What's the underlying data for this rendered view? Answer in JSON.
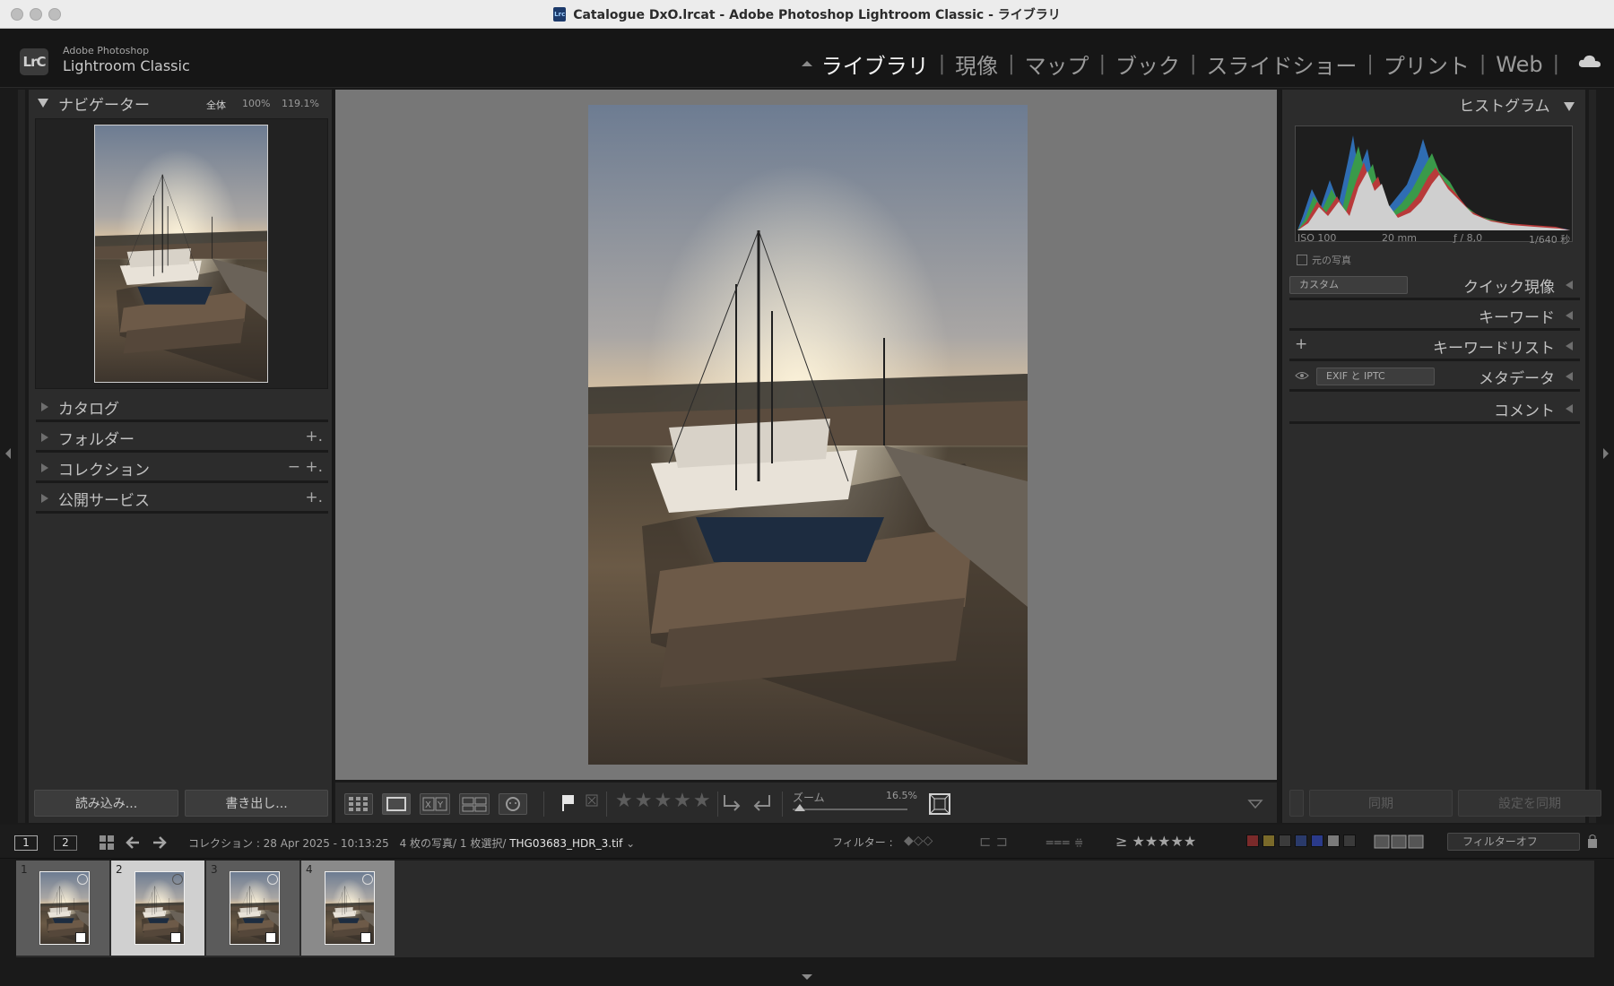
{
  "window": {
    "title": "Catalogue DxO.lrcat - Adobe Photoshop Lightroom Classic - ライブラリ"
  },
  "brand": {
    "line1": "Adobe Photoshop",
    "line2": "Lightroom Classic",
    "logo": "LrC"
  },
  "modules": [
    {
      "label": "ライブラリ",
      "active": true
    },
    {
      "label": "現像"
    },
    {
      "label": "マップ"
    },
    {
      "label": "ブック"
    },
    {
      "label": "スライドショー"
    },
    {
      "label": "プリント"
    },
    {
      "label": "Web"
    }
  ],
  "navigator": {
    "title": "ナビゲーター",
    "fit": "全体",
    "z100": "100%",
    "zcustom": "119.1%"
  },
  "left_sections": [
    {
      "label": "カタログ"
    },
    {
      "label": "フォルダー",
      "action": "+."
    },
    {
      "label": "コレクション",
      "action": "− +."
    },
    {
      "label": "公開サービス",
      "action": "+."
    }
  ],
  "left_buttons": {
    "import": "読み込み...",
    "export": "書き出し..."
  },
  "histogram": {
    "title": "ヒストグラム",
    "iso": "ISO 100",
    "focal": "20 mm",
    "aperture": "ƒ / 8,0",
    "shutter": "1/640 秒",
    "original": "元の写真"
  },
  "right_sections": {
    "quick": {
      "label": "クイック現像",
      "select": "カスタム"
    },
    "keywords": {
      "label": "キーワード"
    },
    "keywordlist": {
      "label": "キーワードリスト",
      "plus": "+"
    },
    "metadata": {
      "label": "メタデータ",
      "select": "EXIF と IPTC"
    },
    "comments": {
      "label": "コメント"
    }
  },
  "right_buttons": {
    "sync": "同期",
    "sync_settings": "設定を同期"
  },
  "toolbar": {
    "zoom_label": "ズーム",
    "zoom_value": "16.5%",
    "stars": "★★★★★",
    "zoom_level": 0.0
  },
  "filmbar": {
    "page1": "1",
    "page2": "2",
    "source": "コレクション : 28 Apr 2025 - 10:13:25",
    "count": "4 枚の写真/ 1 枚選択/",
    "filename": "THG03683_HDR_3.tif",
    "filter_label": "フィルター :",
    "rating_stars": "≥ ★★★★★",
    "filter_select": "フィルターオフ"
  },
  "filmstrip": [
    {
      "num": "1",
      "selected": false
    },
    {
      "num": "2",
      "selected": true
    },
    {
      "num": "3",
      "selected": false
    },
    {
      "num": "4",
      "selected": false
    }
  ],
  "colors": {
    "accent_active": "#f2f2f2",
    "panel_bg": "#2c2c2c",
    "center_bg": "#777777",
    "labels": [
      "#7a2a2a",
      "#7a6a2a",
      "#3b3b3b",
      "#2a3a6a",
      "#2a3a8a",
      "#7a7a7a",
      "#3a3a3a"
    ]
  }
}
